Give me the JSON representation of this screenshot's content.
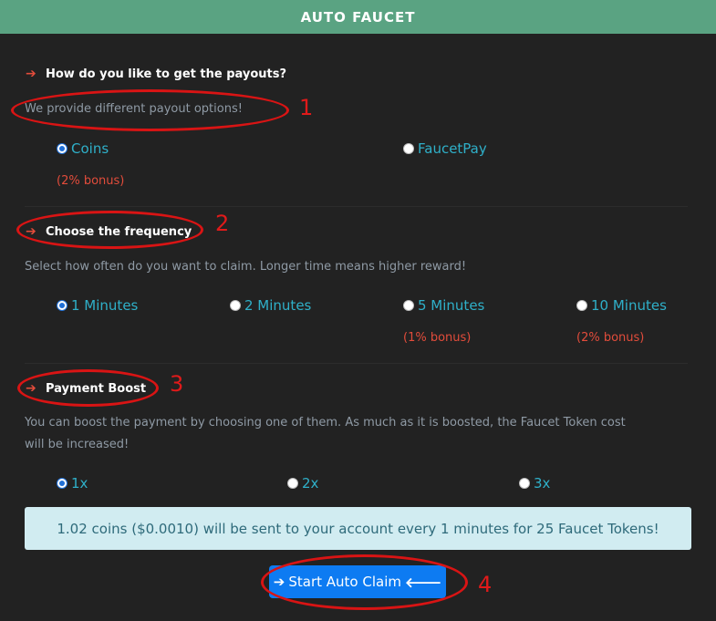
{
  "header": {
    "title": "AUTO FAUCET"
  },
  "payouts": {
    "title": "How do you like to get the payouts?",
    "desc": "We provide different payout options!",
    "options": [
      {
        "label": "Coins",
        "bonus": "(2% bonus)",
        "checked": true
      },
      {
        "label": "FaucetPay",
        "bonus": "",
        "checked": false
      }
    ]
  },
  "frequency": {
    "title": "Choose the frequency",
    "desc": "Select how often do you want to claim. Longer time means higher reward!",
    "options": [
      {
        "label": "1 Minutes",
        "bonus": "",
        "checked": true
      },
      {
        "label": "2 Minutes",
        "bonus": "",
        "checked": false
      },
      {
        "label": "5 Minutes",
        "bonus": "(1% bonus)",
        "checked": false
      },
      {
        "label": "10 Minutes",
        "bonus": "(2% bonus)",
        "checked": false
      }
    ]
  },
  "boost": {
    "title": "Payment Boost",
    "desc_line1": "You can boost the payment by choosing one of them. As much as it is boosted, the Faucet Token cost",
    "desc_line2": "will be increased!",
    "options": [
      {
        "label": "1x",
        "checked": true
      },
      {
        "label": "2x",
        "checked": false
      },
      {
        "label": "3x",
        "checked": false
      }
    ]
  },
  "summary": {
    "text": "1.02 coins ($0.0010) will be sent to your account every 1 minutes for 25 Faucet Tokens!"
  },
  "claim": {
    "label": "Start Auto Claim"
  },
  "annotations": {
    "n1": "1",
    "n2": "2",
    "n3": "3",
    "n4": "4"
  },
  "colors": {
    "header": "#5aa382",
    "accent_arrow": "#e24c3b",
    "option_text": "#2fb0c9",
    "button": "#0d7bf2",
    "annotation": "#d91414"
  }
}
